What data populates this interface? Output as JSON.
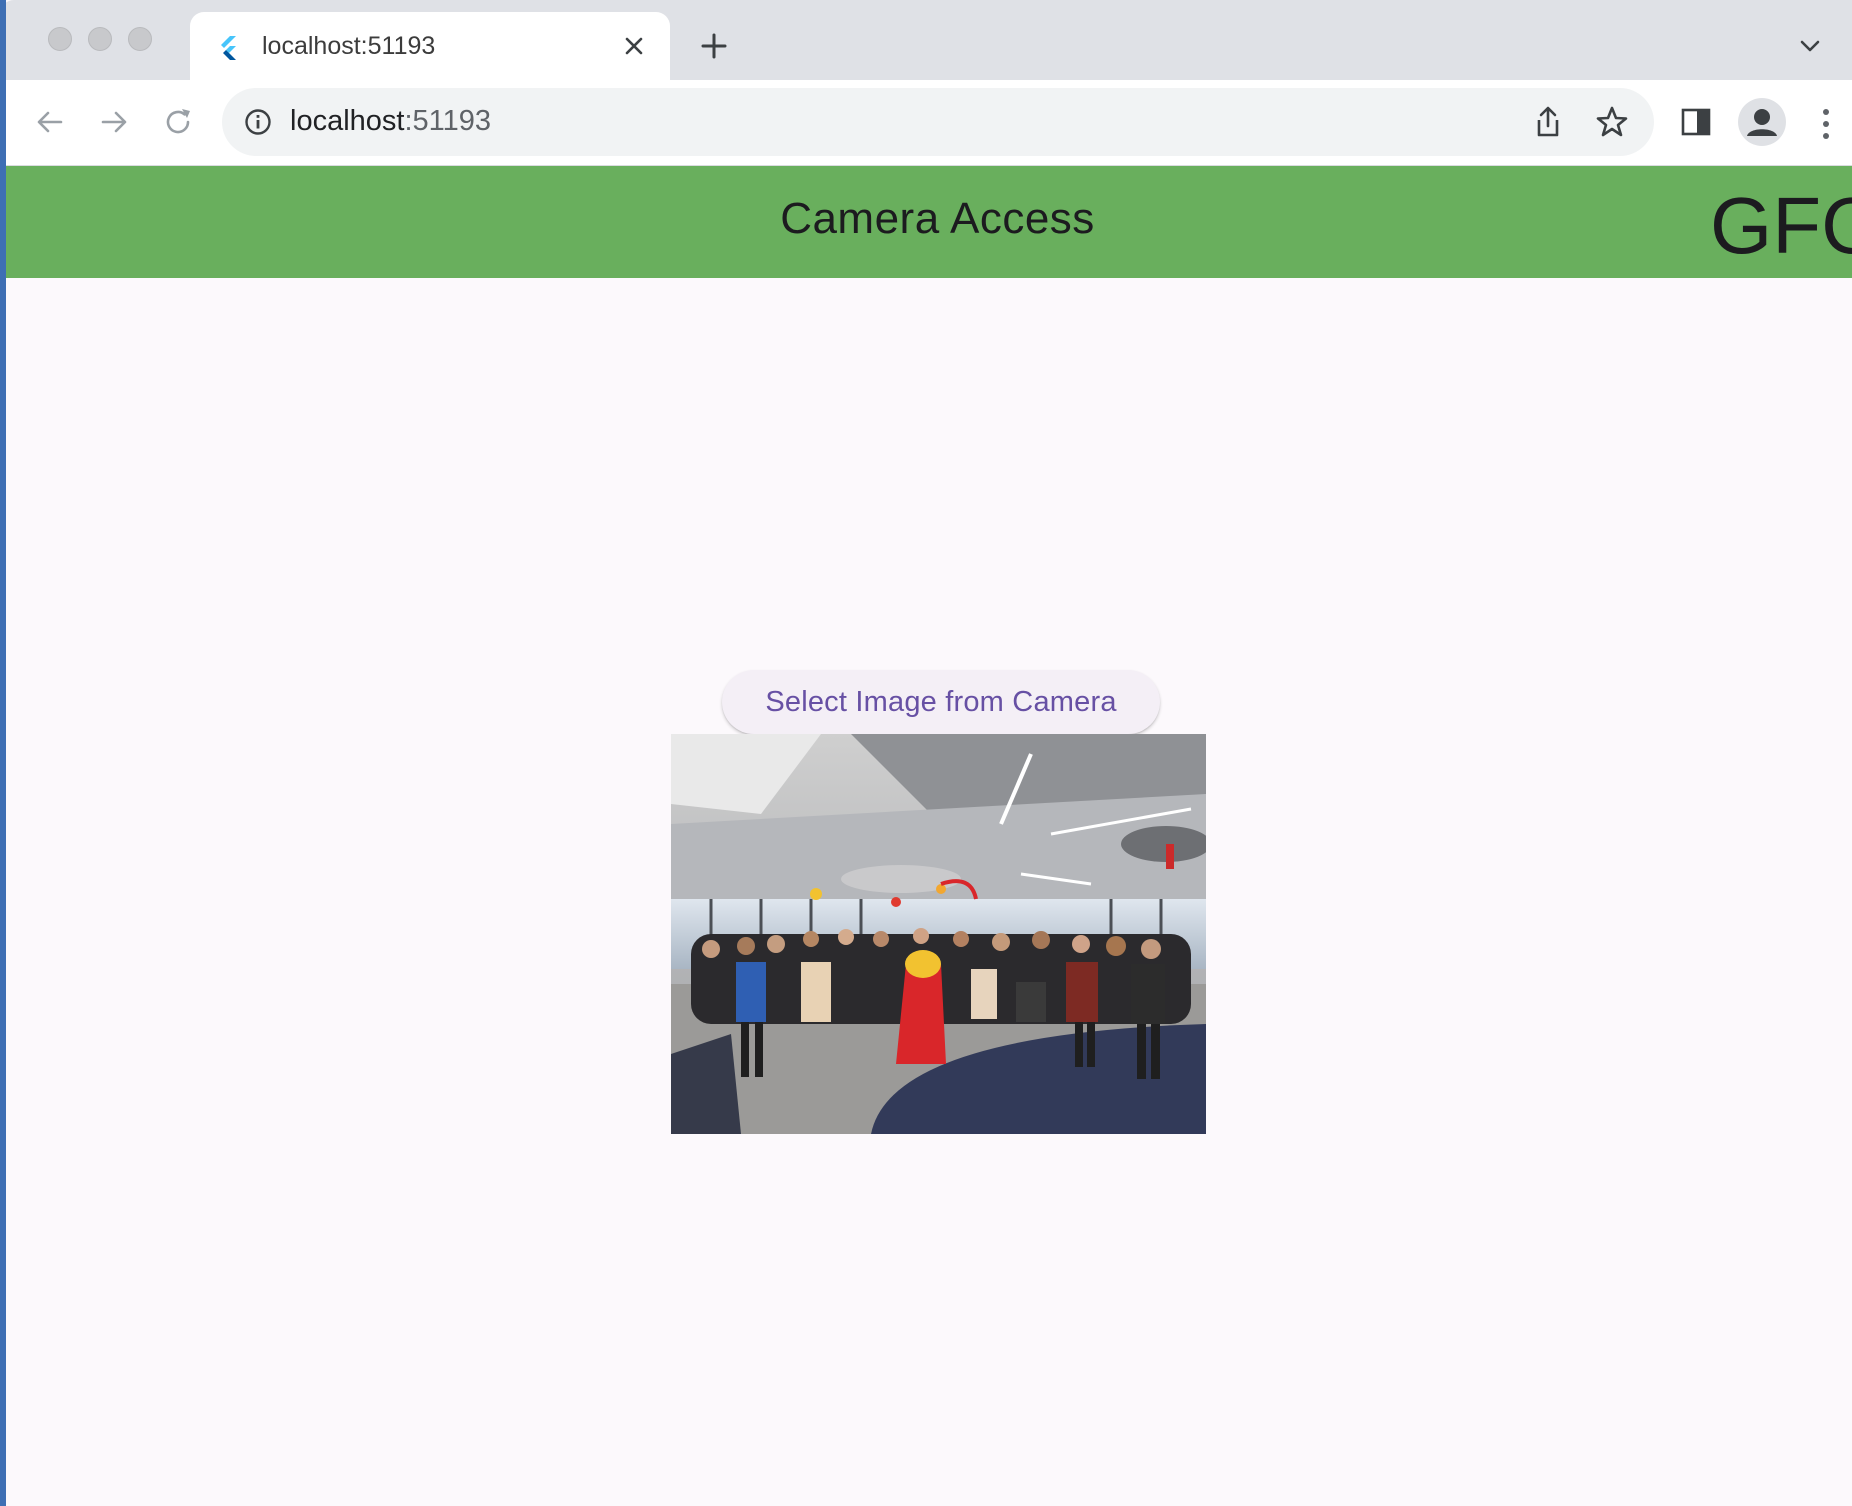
{
  "browser": {
    "tab": {
      "title": "localhost:51193",
      "favicon": "flutter-icon"
    },
    "address_bar": {
      "host": "localhost",
      "port": ":51193"
    },
    "icons": {
      "back": "arrow-left-icon",
      "forward": "arrow-right-icon",
      "reload": "reload-icon",
      "info": "info-icon",
      "share": "share-icon",
      "bookmark": "star-icon",
      "side_panel": "side-panel-icon",
      "profile": "profile-avatar-icon",
      "menu": "kebab-menu-icon",
      "new_tab": "plus-icon",
      "tab_close": "close-icon",
      "tab_search": "chevron-down-icon"
    }
  },
  "app": {
    "app_bar": {
      "title": "Camera Access",
      "logo_text": "GFG",
      "background": "#69af5d"
    },
    "pick_button": {
      "label": "Select Image from Camera",
      "text_color": "#6750a4"
    },
    "image": {
      "alt": "group-photo"
    }
  }
}
